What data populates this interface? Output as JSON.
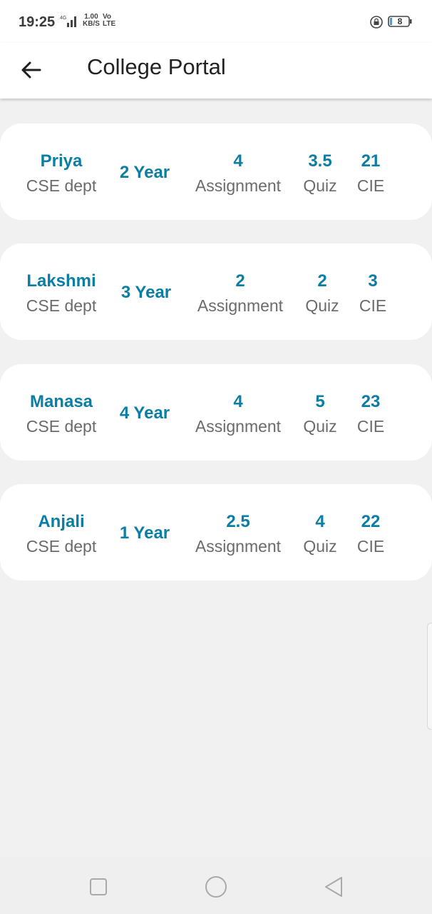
{
  "status_bar": {
    "time": "19:25",
    "speed_value": "1.00",
    "speed_unit": "KB/S",
    "network_top": "Vo",
    "network_bottom": "LTE",
    "battery": "8"
  },
  "app_bar": {
    "title": "College Portal",
    "back_icon": "arrow-left-icon"
  },
  "students": [
    {
      "name": "Priya",
      "dept": "CSE dept",
      "year": "2 Year",
      "assignment": "4",
      "assignment_label": "Assignment",
      "quiz": "3.5",
      "quiz_label": "Quiz",
      "cie": "21",
      "cie_label": "CIE"
    },
    {
      "name": "Lakshmi",
      "dept": "CSE dept",
      "year": "3 Year",
      "assignment": "2",
      "assignment_label": "Assignment",
      "quiz": "2",
      "quiz_label": "Quiz",
      "cie": "3",
      "cie_label": "CIE"
    },
    {
      "name": "Manasa",
      "dept": "CSE dept",
      "year": "4 Year",
      "assignment": "4",
      "assignment_label": "Assignment",
      "quiz": "5",
      "quiz_label": "Quiz",
      "cie": "23",
      "cie_label": "CIE"
    },
    {
      "name": "Anjali",
      "dept": "CSE dept",
      "year": "1 Year",
      "assignment": "2.5",
      "assignment_label": "Assignment",
      "quiz": "4",
      "quiz_label": "Quiz",
      "cie": "22",
      "cie_label": "CIE"
    }
  ],
  "colors": {
    "accent": "#0a7ea4",
    "label": "#6b6b6b",
    "background": "#f1f1f1"
  },
  "nav_bar": {
    "icons": [
      "square-recents-icon",
      "circle-home-icon",
      "triangle-back-icon"
    ]
  }
}
